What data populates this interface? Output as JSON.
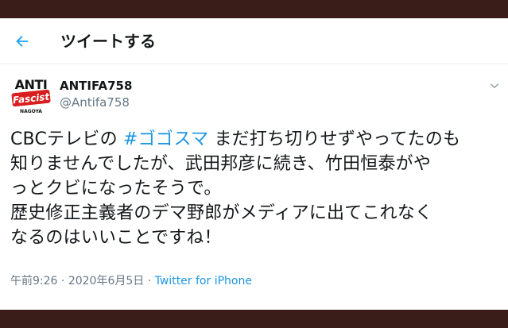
{
  "header": {
    "title": "ツイートする"
  },
  "author": {
    "name": "ANTIFA758",
    "handle": "@Antifa758",
    "avatar_text_top": "ANTI",
    "avatar_text_mid": "Fascist",
    "avatar_text_bottom": "NAGOYA"
  },
  "tweet": {
    "line1_pre": "CBCテレビの ",
    "hashtag": "#ゴゴスマ",
    "line1_post": " まだ打ち切りせずやってたのも",
    "line2": "知りませんでしたが、武田邦彦に続き、竹田恒泰がや",
    "line3": "っとクビになったそうで。",
    "line4": "歴史修正主義者のデマ野郎がメディアに出てこれなく",
    "line5": "なるのはいいことですね！"
  },
  "meta": {
    "time": "午前9:26",
    "separator1": " · ",
    "date": "2020年6月5日",
    "separator2": " · ",
    "source": "Twitter for iPhone"
  },
  "colors": {
    "accent": "#1b95e0",
    "text": "#14171a",
    "secondary": "#657786",
    "background_outer": "#3a1d19"
  },
  "icons": {
    "back": "back-arrow-icon",
    "caret": "chevron-down-icon"
  }
}
